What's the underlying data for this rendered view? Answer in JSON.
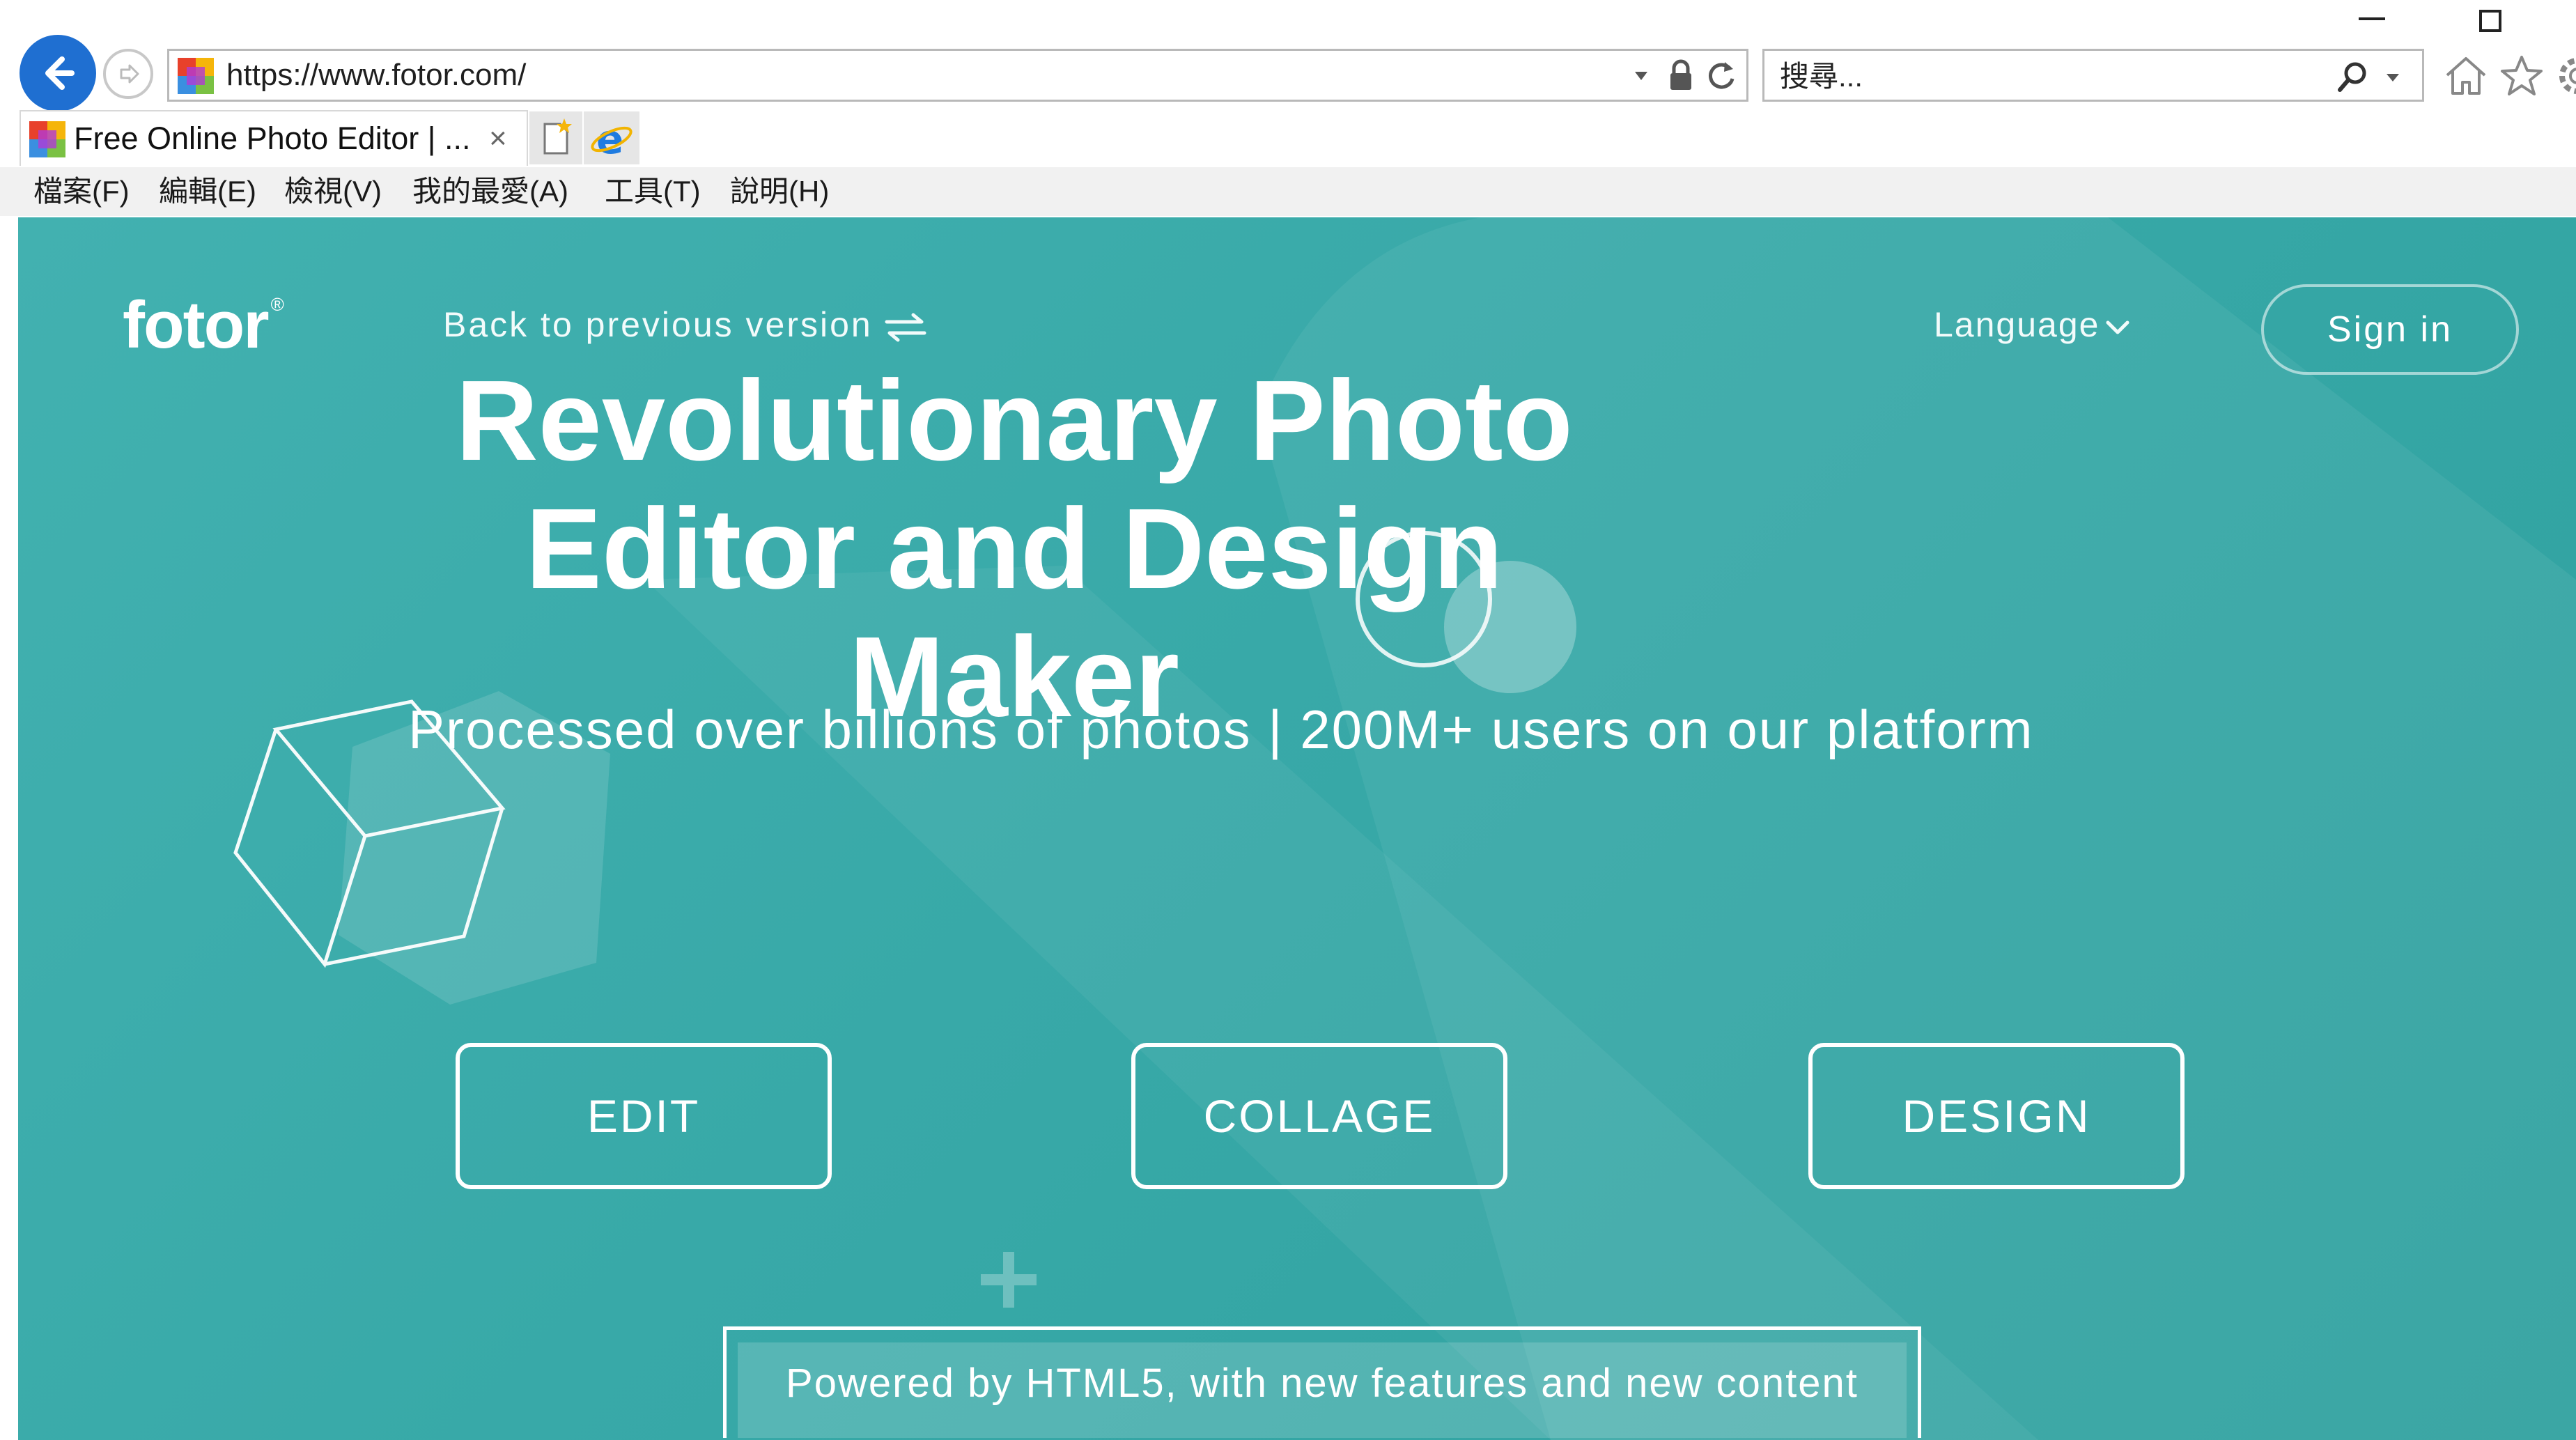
{
  "browser": {
    "url": "https://www.fotor.com/",
    "search_placeholder": "搜尋...",
    "tab": {
      "title": "Free Online Photo Editor | ...",
      "close": "×"
    },
    "menu": [
      "檔案(F)",
      "編輯(E)",
      "檢視(V)",
      "我的最愛(A)",
      "工具(T)",
      "說明(H)"
    ],
    "icons": [
      "back-arrow-icon",
      "forward-arrow-icon",
      "lock-icon",
      "refresh-icon",
      "search-icon",
      "home-icon",
      "star-icon",
      "gear-icon",
      "new-tab-icon",
      "ie-logo-icon"
    ]
  },
  "site": {
    "logo": "fotor",
    "logo_mark": "®",
    "back_link": "Back to previous version",
    "language": "Language",
    "sign_in": "Sign in",
    "hero_title": "Revolutionary Photo Editor and Design Maker",
    "subtitle": "Processed over billions of photos | 200M+ users on our platform",
    "actions": [
      "EDIT",
      "COLLAGE",
      "DESIGN"
    ],
    "powered_banner": "Powered by HTML5, with new features and new content"
  },
  "colors": {
    "page_bg": "#3aaaa9",
    "accent_blue": "#1f6fd1",
    "text_white": "#ffffff"
  }
}
